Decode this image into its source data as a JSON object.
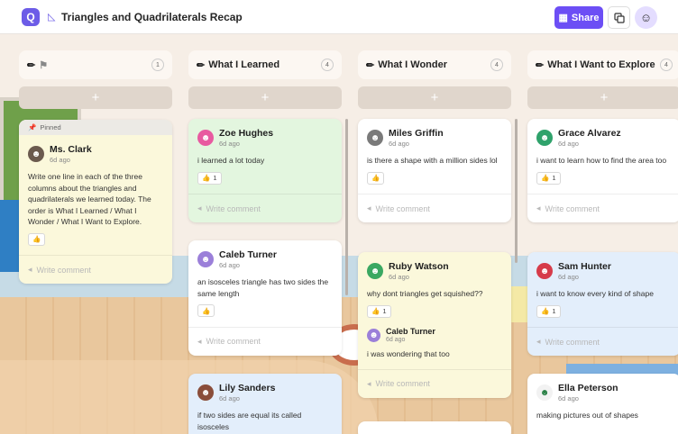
{
  "header": {
    "logo": "Q",
    "title_icon": "ruler-triangle-icon",
    "title": "Triangles and Quadrilaterals Recap",
    "share_label": "Share"
  },
  "columns": [
    {
      "label": "",
      "count": "1",
      "emoji": "pencil-icon"
    },
    {
      "label": "What I Learned",
      "count": "4",
      "emoji": "pencil-icon"
    },
    {
      "label": "What I Wonder",
      "count": "4",
      "emoji": "pencil-icon"
    },
    {
      "label": "What I Want to Explore",
      "count": "4",
      "emoji": "pencil-icon"
    }
  ],
  "add_label": "+",
  "comment_placeholder": "Write comment",
  "pinned_card": {
    "pinned_label": "Pinned",
    "name": "Ms. Clark",
    "time": "6d ago",
    "text": "Write one line in each of the three columns about the triangles and quadrilaterals we learned today. The order is What I Learned / What I Wonder / What I Want to Explore."
  },
  "learned": [
    {
      "name": "Zoe Hughes",
      "time": "6d ago",
      "text": "i learned a lot today",
      "likes": "1"
    },
    {
      "name": "Caleb Turner",
      "time": "6d ago",
      "text": "an isosceles triangle has two sides the same length",
      "likes": ""
    },
    {
      "name": "Lily Sanders",
      "time": "6d ago",
      "text": "if two sides are equal its called isosceles",
      "likes": ""
    }
  ],
  "wonder": [
    {
      "name": "Miles Griffin",
      "time": "6d ago",
      "text": "is there a shape with a million sides lol",
      "likes": ""
    },
    {
      "name": "Ruby Watson",
      "time": "6d ago",
      "text": "why dont triangles get squished??",
      "likes": "1",
      "reply": {
        "name": "Caleb Turner",
        "time": "6d ago",
        "text": "i was wondering that too"
      }
    }
  ],
  "explore": [
    {
      "name": "Grace Alvarez",
      "time": "6d ago",
      "text": "i want to learn how to find the area too",
      "likes": "1"
    },
    {
      "name": "Sam Hunter",
      "time": "6d ago",
      "text": "i want to know every kind of shape",
      "likes": "1"
    },
    {
      "name": "Ella Peterson",
      "time": "6d ago",
      "text": "making pictures out of shapes",
      "likes": ""
    }
  ],
  "colors": {
    "accent": "#6c4ef5",
    "card_yellow": "#fbf8db",
    "card_green": "#e3f6df",
    "card_blue": "#e3eefb"
  }
}
